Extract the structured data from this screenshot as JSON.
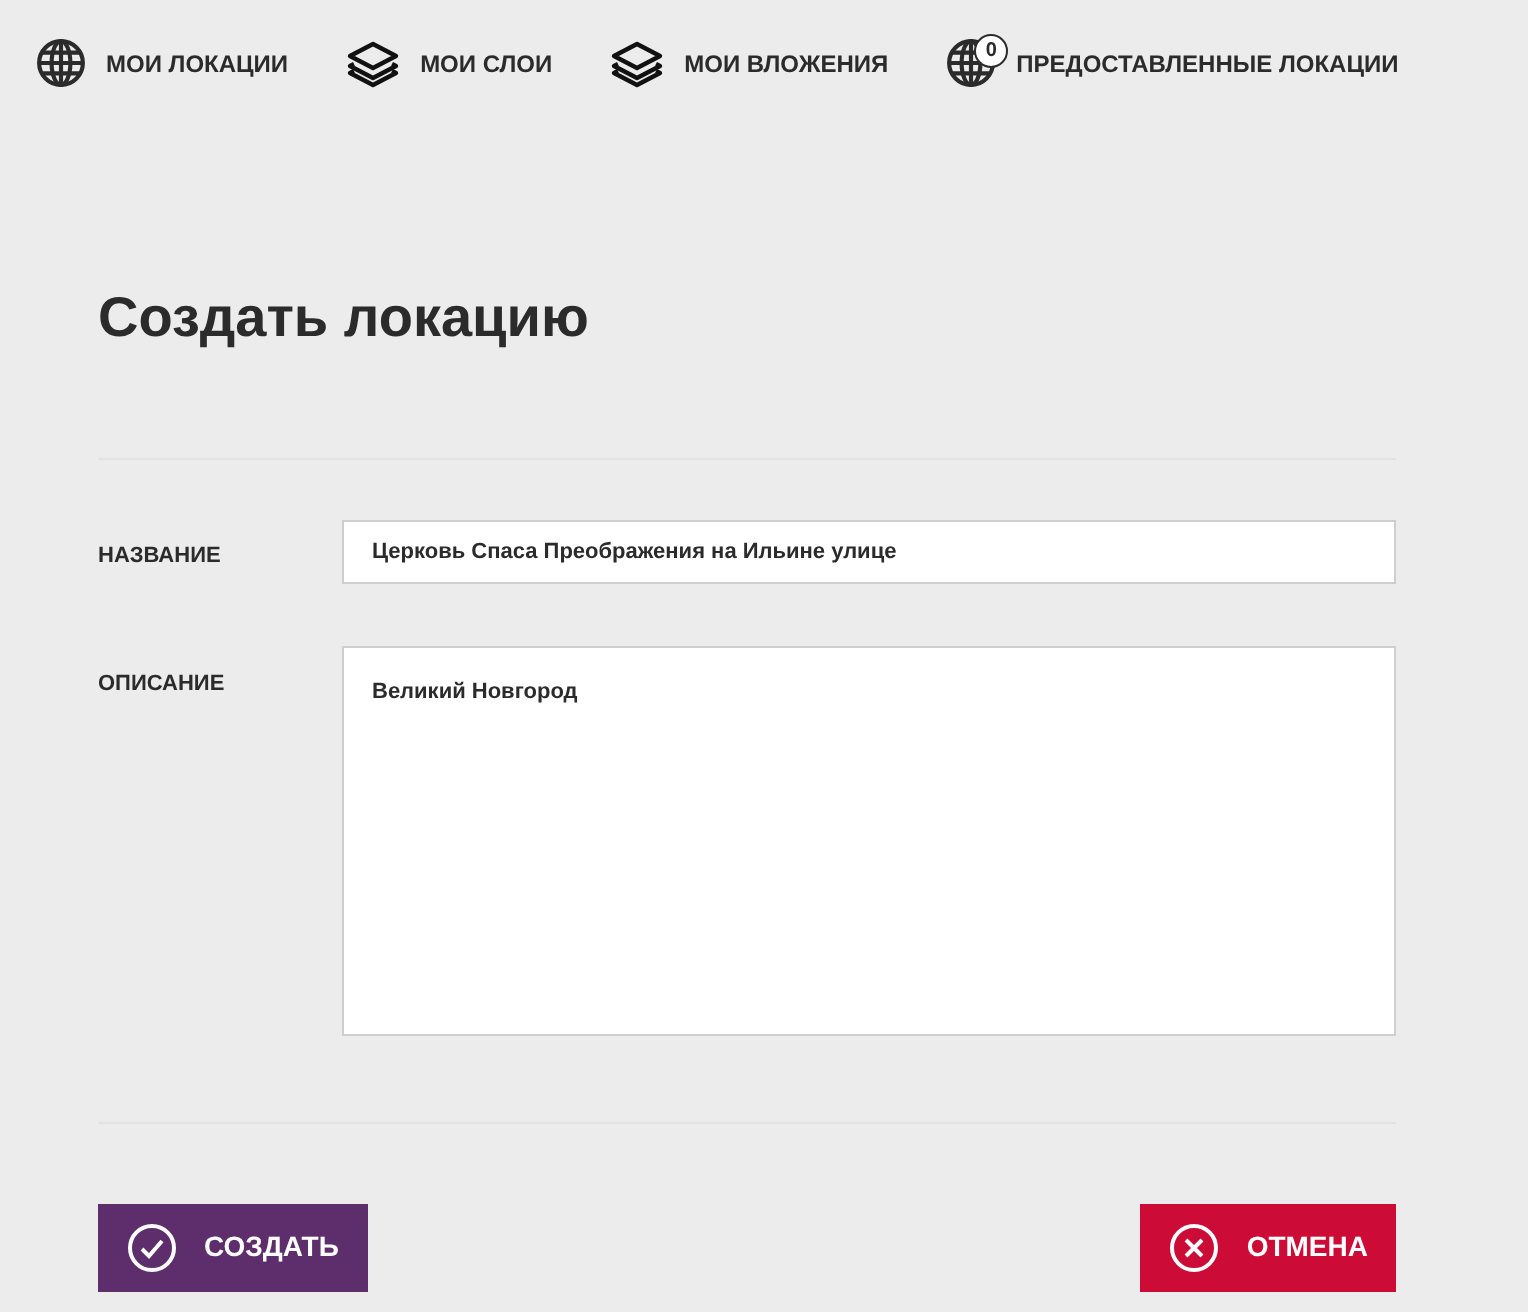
{
  "nav": [
    {
      "kind": "globe",
      "label": "МОИ ЛОКАЦИИ"
    },
    {
      "kind": "layers",
      "label": "МОИ СЛОИ"
    },
    {
      "kind": "layers",
      "label": "МОИ ВЛОЖЕНИЯ"
    },
    {
      "kind": "globe",
      "label": "ПРЕДОСТАВЛЕННЫЕ ЛОКАЦИИ",
      "badge": "0"
    }
  ],
  "title": "Создать локацию",
  "fields": [
    {
      "kind": "input",
      "label": "НАЗВАНИЕ",
      "value": "Церковь Спаса Преображения на Ильине улице"
    },
    {
      "kind": "textarea",
      "label": "ОПИСАНИЕ",
      "value": "Великий Новгород"
    }
  ],
  "buttons": [
    {
      "kind": "confirm",
      "label": "СОЗДАТЬ"
    },
    {
      "kind": "cancel",
      "label": "ОТМЕНА"
    }
  ]
}
